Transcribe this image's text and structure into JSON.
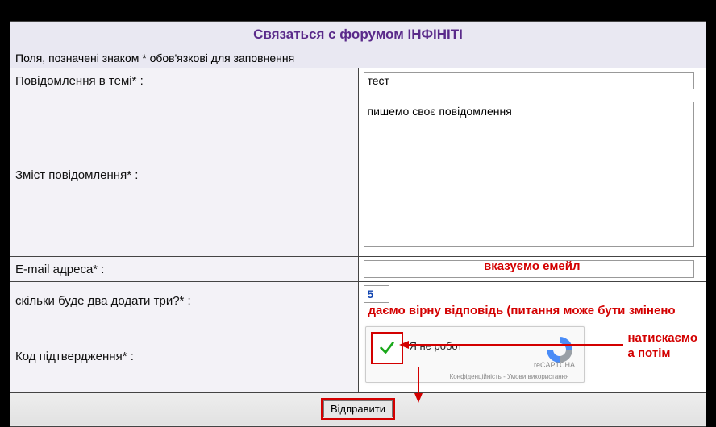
{
  "title": "Связаться с форумом ІНФІНІТІ",
  "help_text": "Поля, позначені знаком * обов'язкові для заповнення",
  "labels": {
    "subject": "Повідомлення в темі* :",
    "body": "Зміст повідомлення* :",
    "email": "E-mail адреса* :",
    "quiz": "скільки буде два додати три?* :",
    "captcha": "Код підтвердження* :"
  },
  "values": {
    "subject": "тест",
    "body": "пишемо своє повідомлення",
    "email": "",
    "quiz": "5"
  },
  "captcha": {
    "label": "Я не робот",
    "brand": "reCAPTCHA",
    "terms": "Конфіденційність - Умови використання",
    "checked": true
  },
  "annotations": {
    "email": "вказуємо емейл",
    "quiz": "даємо вірну відповідь (питання може бути змінено",
    "captcha_line1": "натискаємо",
    "captcha_line2": "а потім"
  },
  "submit_label": "Відправити"
}
